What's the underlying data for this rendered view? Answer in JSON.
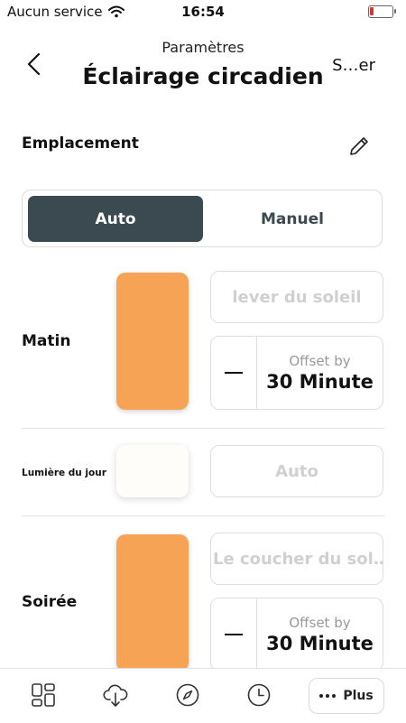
{
  "status_bar": {
    "carrier": "Aucun service",
    "time": "16:54"
  },
  "header": {
    "parent": "Paramètres",
    "title": "Éclairage circadien",
    "right_action": "S…er"
  },
  "location": {
    "label": "Emplacement"
  },
  "mode": {
    "options": [
      "Auto",
      "Manuel"
    ],
    "selected": "Auto"
  },
  "morning": {
    "label": "Matin",
    "color": "#f7a356",
    "trigger": "lever du soleil",
    "offset_caption": "Offset by",
    "offset_value": "30 Minute"
  },
  "daylight": {
    "label": "Lumière du jour",
    "color": "#fffdf9",
    "trigger": "Auto"
  },
  "evening": {
    "label": "Soirée",
    "color": "#f7a356",
    "trigger": "Le coucher du sol…",
    "offset_caption": "Offset by",
    "offset_value": "30 Minute"
  },
  "tabbar": {
    "more_label": "Plus",
    "icons": [
      "dashboard-icon",
      "cloud-download-icon",
      "compass-icon",
      "clock-icon"
    ]
  },
  "colors": {
    "accent_dark": "#3b4951",
    "battery_low": "#e0322e"
  }
}
